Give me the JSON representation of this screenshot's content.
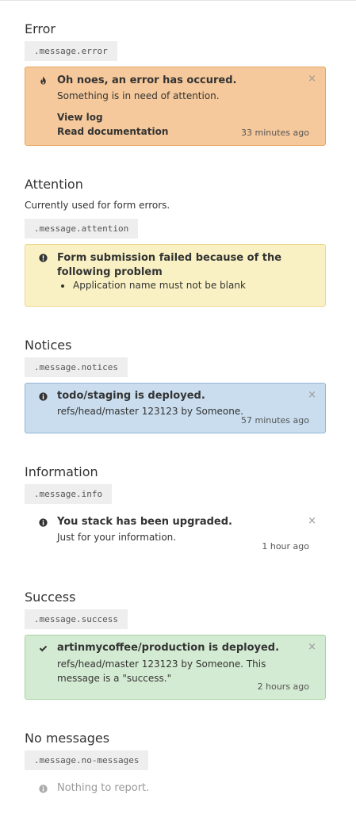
{
  "error": {
    "title": "Error",
    "class_name": ".message.error",
    "message": "Oh noes, an error has occured.",
    "detail": "Something is in need of attention.",
    "link_view_log": "View log",
    "link_docs": "Read documentation",
    "time": "33 minutes ago",
    "icon": "flame-icon",
    "close": "×",
    "color": "#f5c99b"
  },
  "attention": {
    "title": "Attention",
    "description": "Currently used for form errors.",
    "class_name": ".message.attention",
    "message": "Form submission failed because of the following problem",
    "items": [
      "Application name must not be blank"
    ],
    "icon": "exclamation-circle-icon",
    "color": "#f9f1c3"
  },
  "notices": {
    "title": "Notices",
    "class_name": ".message.notices",
    "message": "todo/staging is deployed.",
    "detail": "refs/head/master 123123 by Someone.",
    "time": "57 minutes ago",
    "icon": "info-circle-icon",
    "close": "×",
    "color": "#c9ddee"
  },
  "information": {
    "title": "Information",
    "class_name": ".message.info",
    "message": "You stack has been upgraded.",
    "detail": "Just for your information.",
    "time": "1 hour ago",
    "icon": "info-circle-icon",
    "close": "×"
  },
  "success": {
    "title": "Success",
    "class_name": ".message.success",
    "message": "artinmycoffee/production is deployed.",
    "detail": "refs/head/master 123123 by Someone. This message is a \"success.\"",
    "time": "2 hours ago",
    "icon": "checkmark-icon",
    "close": "×",
    "color": "#d4ebd3"
  },
  "no_messages": {
    "title": "No messages",
    "class_name": ".message.no-messages",
    "message": "Nothing to report.",
    "icon": "info-circle-icon"
  }
}
